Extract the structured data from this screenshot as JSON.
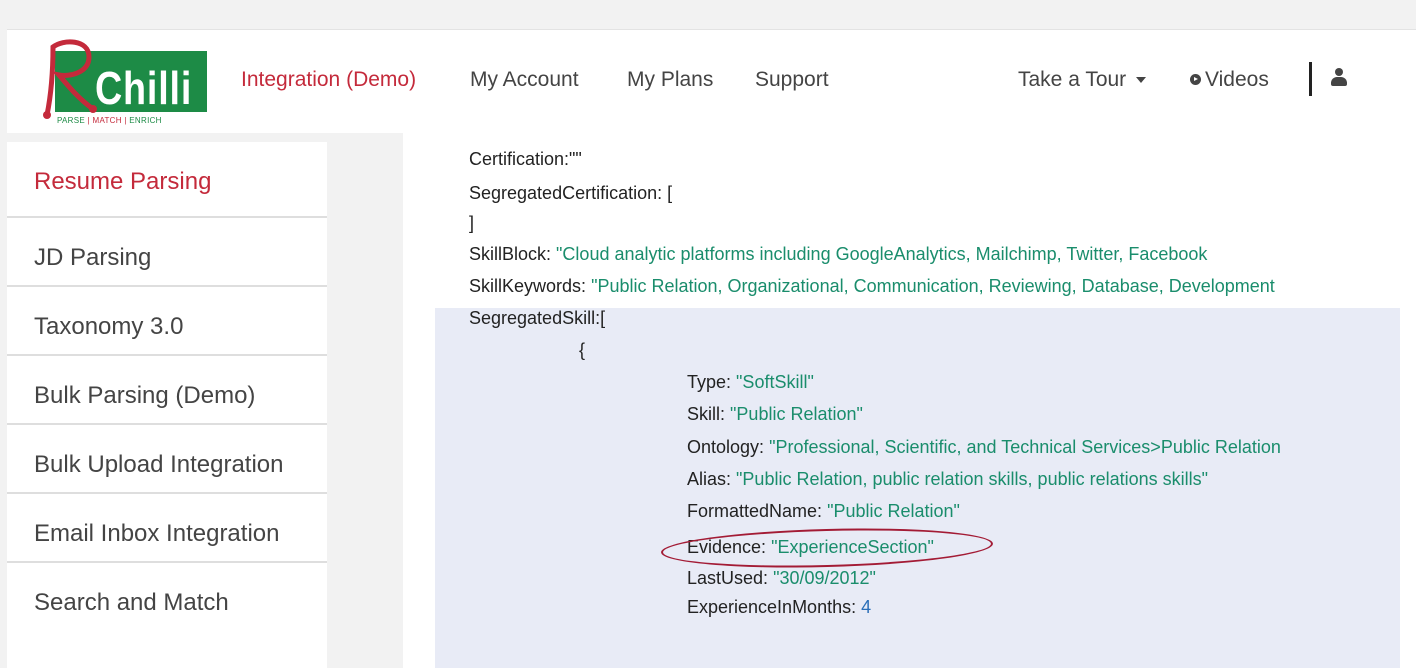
{
  "brand": {
    "name": "Chilli",
    "initial": "R",
    "tagline_parts": [
      "PARSE",
      "MATCH",
      "ENRICH"
    ],
    "separator": "|",
    "colors": {
      "green": "#1d8b46",
      "red": "#c42a3b"
    }
  },
  "topnav": {
    "items": [
      {
        "label": "Integration (Demo)",
        "active": true
      },
      {
        "label": "My Account",
        "active": false
      },
      {
        "label": "My Plans",
        "active": false
      },
      {
        "label": "Support",
        "active": false
      }
    ],
    "tour_label": "Take a Tour",
    "videos_label": "Videos",
    "icons": {
      "tour": "caret-down-icon",
      "videos": "play-circle-icon",
      "user": "user-icon"
    }
  },
  "sidebar": {
    "items": [
      {
        "label": "Resume Parsing",
        "active": true
      },
      {
        "label": "JD Parsing",
        "active": false
      },
      {
        "label": "Taxonomy 3.0",
        "active": false
      },
      {
        "label": "Bulk Parsing (Demo)",
        "active": false
      },
      {
        "label": "Bulk Upload Integration",
        "active": false
      },
      {
        "label": "Email Inbox Integration",
        "active": false
      },
      {
        "label": "Search and Match",
        "active": false
      }
    ]
  },
  "code": {
    "certification_key": "Certification:",
    "certification_val": "\"\"",
    "segregated_cert_key": "SegregatedCertification: [",
    "segregated_cert_close": "]",
    "skillblock_key": "SkillBlock:",
    "skillblock_val": "\"Cloud analytic platforms including GoogleAnalytics, Mailchimp, Twitter, Facebook",
    "skillkeywords_key": "SkillKeywords:",
    "skillkeywords_val": "\"Public Relation, Organizational, Communication, Reviewing, Database, Development",
    "segregated_skill_key": "SegregatedSkill:[",
    "brace_open": "{",
    "type_key": "Type:",
    "type_val": "\"SoftSkill\"",
    "skill_key": "Skill:",
    "skill_val": "\"Public Relation\"",
    "ontology_key": "Ontology:",
    "ontology_val": "\"Professional, Scientific, and Technical Services>Public Relation",
    "alias_key": "Alias:",
    "alias_val": "\"Public Relation, public relation skills, public relations  skills\"",
    "formatted_key": "FormattedName:",
    "formatted_val": "\"Public Relation\"",
    "evidence_key": "Evidence:",
    "evidence_val": "\"ExperienceSection\"",
    "lastused_key": "LastUsed:",
    "lastused_val": "\"30/09/2012\"",
    "experience_key": "ExperienceInMonths:",
    "experience_val": "4"
  }
}
